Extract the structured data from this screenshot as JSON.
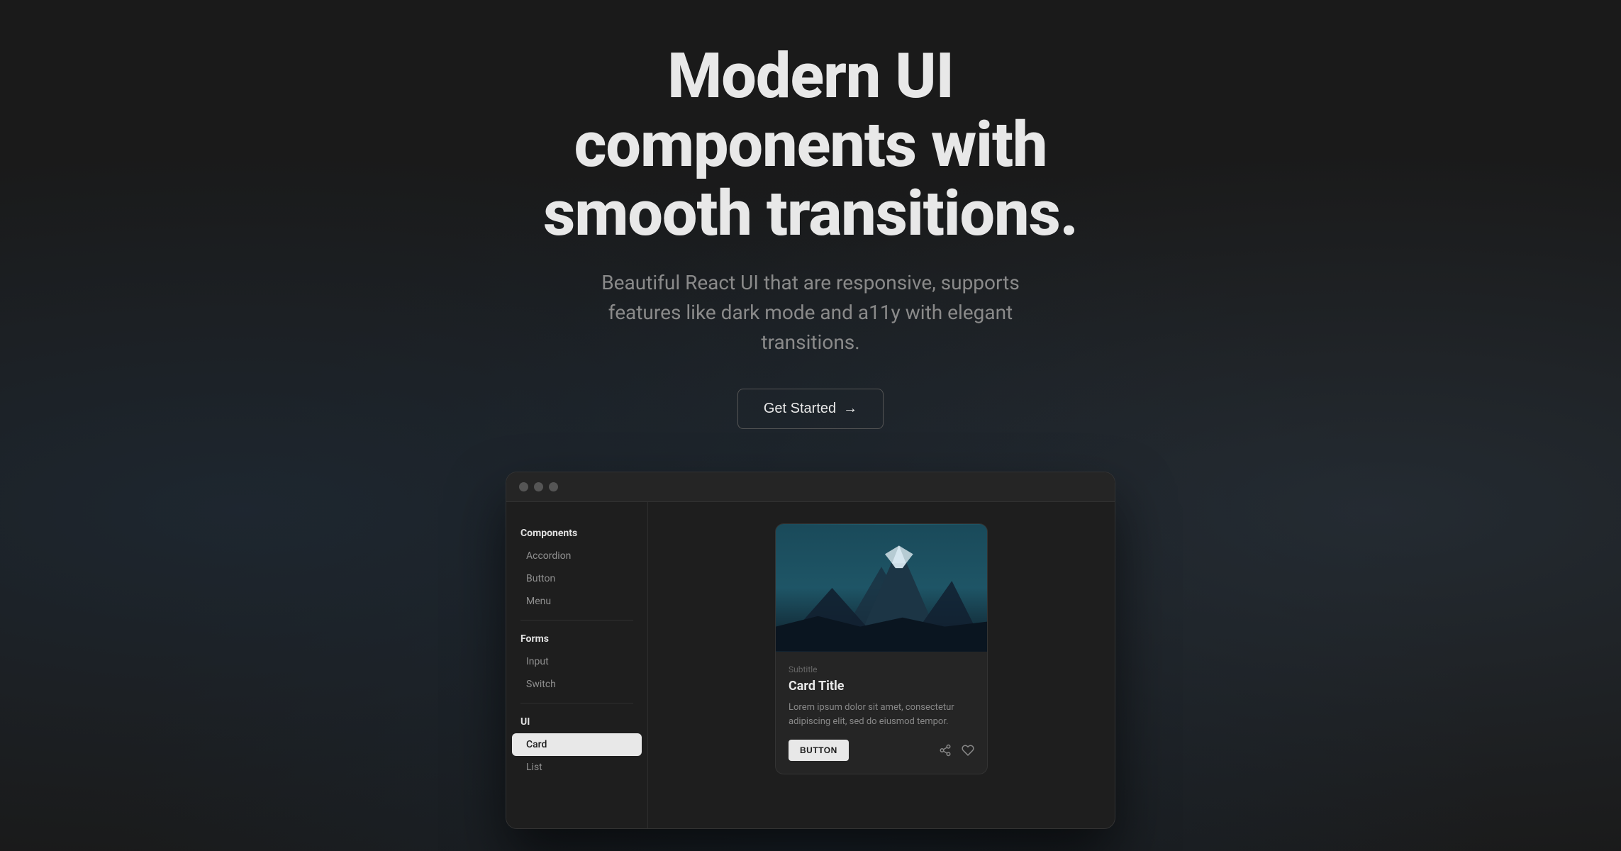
{
  "hero": {
    "title_line1": "Modern UI components with",
    "title_line2": "smooth transitions.",
    "subtitle": "Beautiful React UI that are responsive, supports features like dark mode and a11y with elegant transitions.",
    "cta_label": "Get Started",
    "cta_arrow": "→"
  },
  "window": {
    "traffic_lights": [
      "red",
      "yellow",
      "green"
    ]
  },
  "sidebar": {
    "sections": [
      {
        "header": "Components",
        "items": [
          {
            "label": "Accordion",
            "active": false
          },
          {
            "label": "Button",
            "active": false
          },
          {
            "label": "Menu",
            "active": false
          }
        ]
      },
      {
        "header": "Forms",
        "items": [
          {
            "label": "Input",
            "active": false
          },
          {
            "label": "Switch",
            "active": false
          }
        ]
      },
      {
        "header": "UI",
        "items": [
          {
            "label": "Card",
            "active": true
          },
          {
            "label": "List",
            "active": false
          }
        ]
      }
    ]
  },
  "card": {
    "subtitle": "Subtitle",
    "title": "Card Title",
    "text": "Lorem ipsum dolor sit amet, consectetur adipiscing elit, sed do eiusmod tempor.",
    "button_label": "BUTTON",
    "share_icon": "share-icon",
    "heart_icon": "heart-icon"
  },
  "colors": {
    "background": "#1a1a1a",
    "surface": "#1e1e1e",
    "border": "#333333",
    "text_primary": "#e8e8e8",
    "text_secondary": "#8a8a8a",
    "accent": "#e8e8e8"
  }
}
